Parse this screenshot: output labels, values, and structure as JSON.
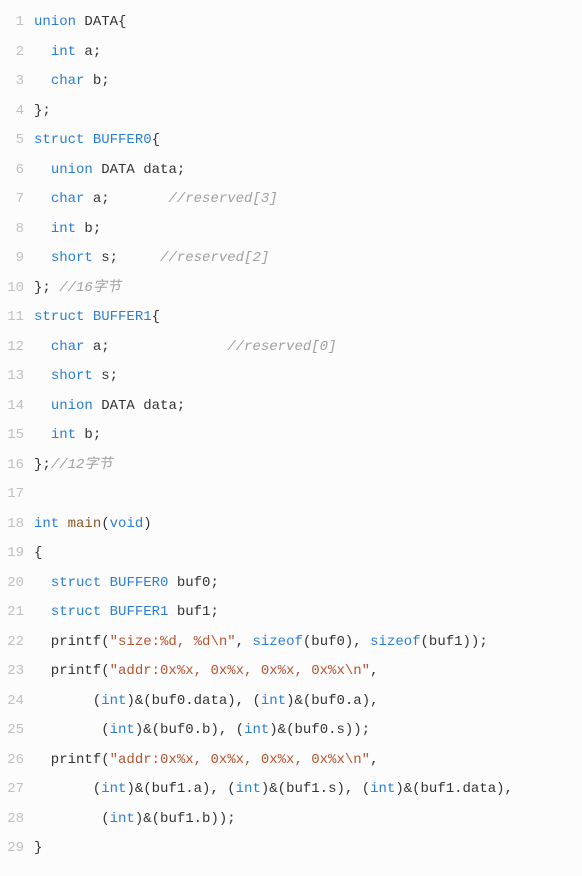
{
  "lines": [
    {
      "n": 1,
      "tokens": [
        {
          "c": "kw",
          "t": "union"
        },
        {
          "c": "pl",
          "t": " DATA{"
        }
      ]
    },
    {
      "n": 2,
      "tokens": [
        {
          "c": "pl",
          "t": "  "
        },
        {
          "c": "kw",
          "t": "int"
        },
        {
          "c": "pl",
          "t": " a;"
        }
      ]
    },
    {
      "n": 3,
      "tokens": [
        {
          "c": "pl",
          "t": "  "
        },
        {
          "c": "kw",
          "t": "char"
        },
        {
          "c": "pl",
          "t": " b;"
        }
      ]
    },
    {
      "n": 4,
      "tokens": [
        {
          "c": "pl",
          "t": "};"
        }
      ]
    },
    {
      "n": 5,
      "tokens": [
        {
          "c": "kw",
          "t": "struct"
        },
        {
          "c": "pl",
          "t": " "
        },
        {
          "c": "type",
          "t": "BUFFER0"
        },
        {
          "c": "pl",
          "t": "{"
        }
      ]
    },
    {
      "n": 6,
      "tokens": [
        {
          "c": "pl",
          "t": "  "
        },
        {
          "c": "kw",
          "t": "union"
        },
        {
          "c": "pl",
          "t": " DATA data;"
        }
      ]
    },
    {
      "n": 7,
      "tokens": [
        {
          "c": "pl",
          "t": "  "
        },
        {
          "c": "kw",
          "t": "char"
        },
        {
          "c": "pl",
          "t": " a;       "
        },
        {
          "c": "cmt",
          "t": "//reserved[3]"
        }
      ]
    },
    {
      "n": 8,
      "tokens": [
        {
          "c": "pl",
          "t": "  "
        },
        {
          "c": "kw",
          "t": "int"
        },
        {
          "c": "pl",
          "t": " b;"
        }
      ]
    },
    {
      "n": 9,
      "tokens": [
        {
          "c": "pl",
          "t": "  "
        },
        {
          "c": "kw",
          "t": "short"
        },
        {
          "c": "pl",
          "t": " s;     "
        },
        {
          "c": "cmt",
          "t": "//reserved[2]"
        }
      ]
    },
    {
      "n": 10,
      "tokens": [
        {
          "c": "pl",
          "t": "}; "
        },
        {
          "c": "cmt",
          "t": "//16字节"
        }
      ]
    },
    {
      "n": 11,
      "tokens": [
        {
          "c": "kw",
          "t": "struct"
        },
        {
          "c": "pl",
          "t": " "
        },
        {
          "c": "type",
          "t": "BUFFER1"
        },
        {
          "c": "pl",
          "t": "{"
        }
      ]
    },
    {
      "n": 12,
      "tokens": [
        {
          "c": "pl",
          "t": "  "
        },
        {
          "c": "kw",
          "t": "char"
        },
        {
          "c": "pl",
          "t": " a;              "
        },
        {
          "c": "cmt",
          "t": "//reserved[0]"
        }
      ]
    },
    {
      "n": 13,
      "tokens": [
        {
          "c": "pl",
          "t": "  "
        },
        {
          "c": "kw",
          "t": "short"
        },
        {
          "c": "pl",
          "t": " s;"
        }
      ]
    },
    {
      "n": 14,
      "tokens": [
        {
          "c": "pl",
          "t": "  "
        },
        {
          "c": "kw",
          "t": "union"
        },
        {
          "c": "pl",
          "t": " DATA data;"
        }
      ]
    },
    {
      "n": 15,
      "tokens": [
        {
          "c": "pl",
          "t": "  "
        },
        {
          "c": "kw",
          "t": "int"
        },
        {
          "c": "pl",
          "t": " b;"
        }
      ]
    },
    {
      "n": 16,
      "tokens": [
        {
          "c": "pl",
          "t": "};"
        },
        {
          "c": "cmt",
          "t": "//12字节"
        }
      ]
    },
    {
      "n": 17,
      "tokens": [
        {
          "c": "pl",
          "t": ""
        }
      ]
    },
    {
      "n": 18,
      "tokens": [
        {
          "c": "kw",
          "t": "int"
        },
        {
          "c": "pl",
          "t": " "
        },
        {
          "c": "fn",
          "t": "main"
        },
        {
          "c": "pl",
          "t": "("
        },
        {
          "c": "kw",
          "t": "void"
        },
        {
          "c": "pl",
          "t": ")"
        }
      ]
    },
    {
      "n": 19,
      "tokens": [
        {
          "c": "pl",
          "t": "{"
        }
      ]
    },
    {
      "n": 20,
      "tokens": [
        {
          "c": "pl",
          "t": "  "
        },
        {
          "c": "kw",
          "t": "struct"
        },
        {
          "c": "pl",
          "t": " "
        },
        {
          "c": "type",
          "t": "BUFFER0"
        },
        {
          "c": "pl",
          "t": " buf0;"
        }
      ]
    },
    {
      "n": 21,
      "tokens": [
        {
          "c": "pl",
          "t": "  "
        },
        {
          "c": "kw",
          "t": "struct"
        },
        {
          "c": "pl",
          "t": " "
        },
        {
          "c": "type",
          "t": "BUFFER1"
        },
        {
          "c": "pl",
          "t": " buf1;"
        }
      ]
    },
    {
      "n": 22,
      "tokens": [
        {
          "c": "pl",
          "t": "  printf("
        },
        {
          "c": "str",
          "t": "\"size:%d, %d\\n\""
        },
        {
          "c": "pl",
          "t": ", "
        },
        {
          "c": "kw",
          "t": "sizeof"
        },
        {
          "c": "pl",
          "t": "(buf0), "
        },
        {
          "c": "kw",
          "t": "sizeof"
        },
        {
          "c": "pl",
          "t": "(buf1));"
        }
      ]
    },
    {
      "n": 23,
      "tokens": [
        {
          "c": "pl",
          "t": "  printf("
        },
        {
          "c": "str",
          "t": "\"addr:0x%x, 0x%x, 0x%x, 0x%x\\n\""
        },
        {
          "c": "pl",
          "t": ","
        }
      ]
    },
    {
      "n": 24,
      "tokens": [
        {
          "c": "pl",
          "t": "       ("
        },
        {
          "c": "kw",
          "t": "int"
        },
        {
          "c": "pl",
          "t": ")&(buf0.data), ("
        },
        {
          "c": "kw",
          "t": "int"
        },
        {
          "c": "pl",
          "t": ")&(buf0.a),"
        }
      ]
    },
    {
      "n": 25,
      "tokens": [
        {
          "c": "pl",
          "t": "        ("
        },
        {
          "c": "kw",
          "t": "int"
        },
        {
          "c": "pl",
          "t": ")&(buf0.b), ("
        },
        {
          "c": "kw",
          "t": "int"
        },
        {
          "c": "pl",
          "t": ")&(buf0.s));"
        }
      ]
    },
    {
      "n": 26,
      "tokens": [
        {
          "c": "pl",
          "t": "  printf("
        },
        {
          "c": "str",
          "t": "\"addr:0x%x, 0x%x, 0x%x, 0x%x\\n\""
        },
        {
          "c": "pl",
          "t": ","
        }
      ]
    },
    {
      "n": 27,
      "tokens": [
        {
          "c": "pl",
          "t": "       ("
        },
        {
          "c": "kw",
          "t": "int"
        },
        {
          "c": "pl",
          "t": ")&(buf1.a), ("
        },
        {
          "c": "kw",
          "t": "int"
        },
        {
          "c": "pl",
          "t": ")&(buf1.s), ("
        },
        {
          "c": "kw",
          "t": "int"
        },
        {
          "c": "pl",
          "t": ")&(buf1.data),"
        }
      ]
    },
    {
      "n": 28,
      "tokens": [
        {
          "c": "pl",
          "t": "        ("
        },
        {
          "c": "kw",
          "t": "int"
        },
        {
          "c": "pl",
          "t": ")&(buf1.b));"
        }
      ]
    },
    {
      "n": 29,
      "tokens": [
        {
          "c": "pl",
          "t": "}"
        }
      ]
    }
  ]
}
